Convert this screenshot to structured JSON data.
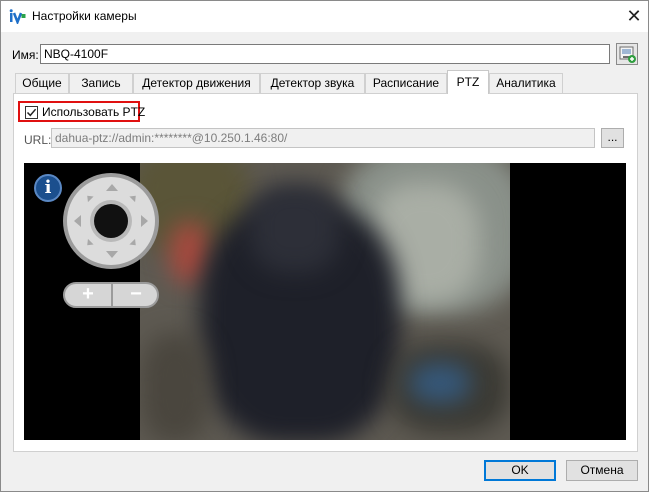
{
  "window": {
    "title": "Настройки камеры",
    "app_icon": "iv-logo-icon",
    "close_glyph": "✕"
  },
  "name_field": {
    "label": "Имя:",
    "value": "NBQ-4100F",
    "export_icon": "export-icon"
  },
  "tabs": [
    {
      "label": "Общие"
    },
    {
      "label": "Запись"
    },
    {
      "label": "Детектор движения"
    },
    {
      "label": "Детектор звука"
    },
    {
      "label": "Расписание"
    },
    {
      "label": "PTZ",
      "active": true
    },
    {
      "label": "Аналитика"
    }
  ],
  "ptz": {
    "use_ptz_label": "Использовать PTZ",
    "use_ptz_checked": true,
    "url_label": "URL:",
    "url_value": "dahua-ptz://admin:********@10.250.1.46:80/",
    "browse_label": "..."
  },
  "video_controls": {
    "info_glyph": "i",
    "zoom_in": "+",
    "zoom_out": "−"
  },
  "buttons": {
    "ok": "OK",
    "cancel": "Отмена"
  },
  "colors": {
    "highlight_border": "#e01010",
    "accent": "#0078d7"
  }
}
